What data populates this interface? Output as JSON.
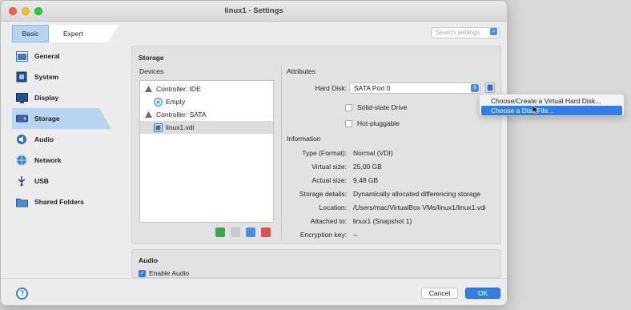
{
  "window": {
    "title": "linux1 - Settings"
  },
  "mode": {
    "basic": "Basic",
    "expert": "Expert"
  },
  "search": {
    "placeholder": "Search settings"
  },
  "sidebar": {
    "items": [
      {
        "label": "General",
        "icon": "general-icon"
      },
      {
        "label": "System",
        "icon": "system-icon"
      },
      {
        "label": "Display",
        "icon": "display-icon"
      },
      {
        "label": "Storage",
        "icon": "storage-icon"
      },
      {
        "label": "Audio",
        "icon": "audio-icon"
      },
      {
        "label": "Network",
        "icon": "network-icon"
      },
      {
        "label": "USB",
        "icon": "usb-icon"
      },
      {
        "label": "Shared Folders",
        "icon": "shared-folders-icon"
      }
    ],
    "active": "Storage"
  },
  "storage": {
    "title": "Storage",
    "devices_label": "Devices",
    "tree": [
      {
        "label": "Controller: IDE",
        "level": 0
      },
      {
        "label": "Empty",
        "level": 1
      },
      {
        "label": "Controller: SATA",
        "level": 0
      },
      {
        "label": "linux1.vdi",
        "level": 1,
        "selected": true
      }
    ]
  },
  "attributes": {
    "title": "Attributes",
    "hard_disk_label": "Hard Disk:",
    "hard_disk_value": "SATA Port 0",
    "ssd_label": "Solid-state Drive",
    "hotplug_label": "Hot-pluggable"
  },
  "information": {
    "title": "Information",
    "rows": [
      {
        "label": "Type (Format):",
        "value": "Normal (VDI)"
      },
      {
        "label": "Virtual size:",
        "value": "25,00 GB"
      },
      {
        "label": "Actual size:",
        "value": "9,48 GB"
      },
      {
        "label": "Storage details:",
        "value": "Dynamically allocated differencing storage"
      },
      {
        "label": "Location:",
        "value": "/Users/mac/VirtualBox VMs/linux1/linux1.vdi"
      },
      {
        "label": "Attached to:",
        "value": "linux1 (Snapshot 1)"
      },
      {
        "label": "Encryption key:",
        "value": "--"
      }
    ]
  },
  "audio": {
    "title": "Audio",
    "enable_label": "Enable Audio"
  },
  "menu": {
    "items": [
      "Choose/Create a Virtual Hard Disk...",
      "Choose a Disk File..."
    ]
  },
  "footer": {
    "help": "?",
    "cancel": "Cancel",
    "ok": "OK"
  },
  "colors": {
    "accent": "#2f7ee8",
    "selection": "#b7d4f0"
  }
}
